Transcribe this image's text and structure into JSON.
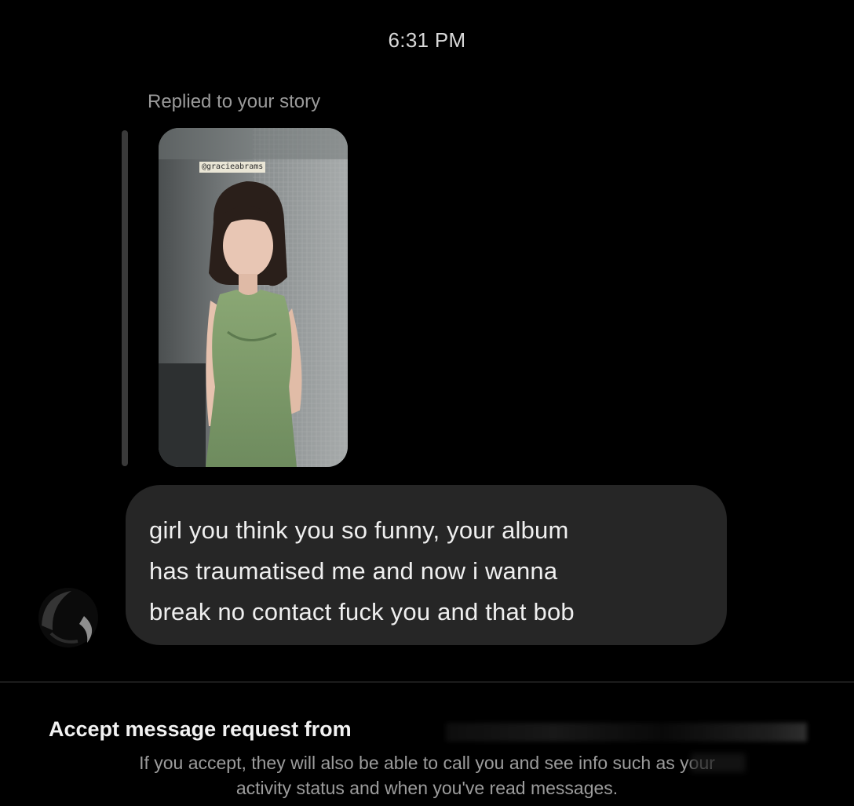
{
  "thread": {
    "timestamp": "6:31 PM",
    "reply_label": "Replied to your story",
    "story": {
      "mention_tag": "@gracieabrams"
    },
    "message": {
      "line1": "girl you think you so funny, your album",
      "line2": "has traumatised me and now i wanna",
      "line3": "break no contact fuck you and that bob"
    }
  },
  "request": {
    "title": "Accept message request from",
    "description_line1": "If you accept, they will also be able to call you and see info such as your",
    "description_line2": "activity status and when you've read messages."
  },
  "colors": {
    "background": "#000000",
    "bubble": "#262626",
    "secondary_text": "#9a9a9a",
    "dress_green": "#7f9d6a"
  }
}
